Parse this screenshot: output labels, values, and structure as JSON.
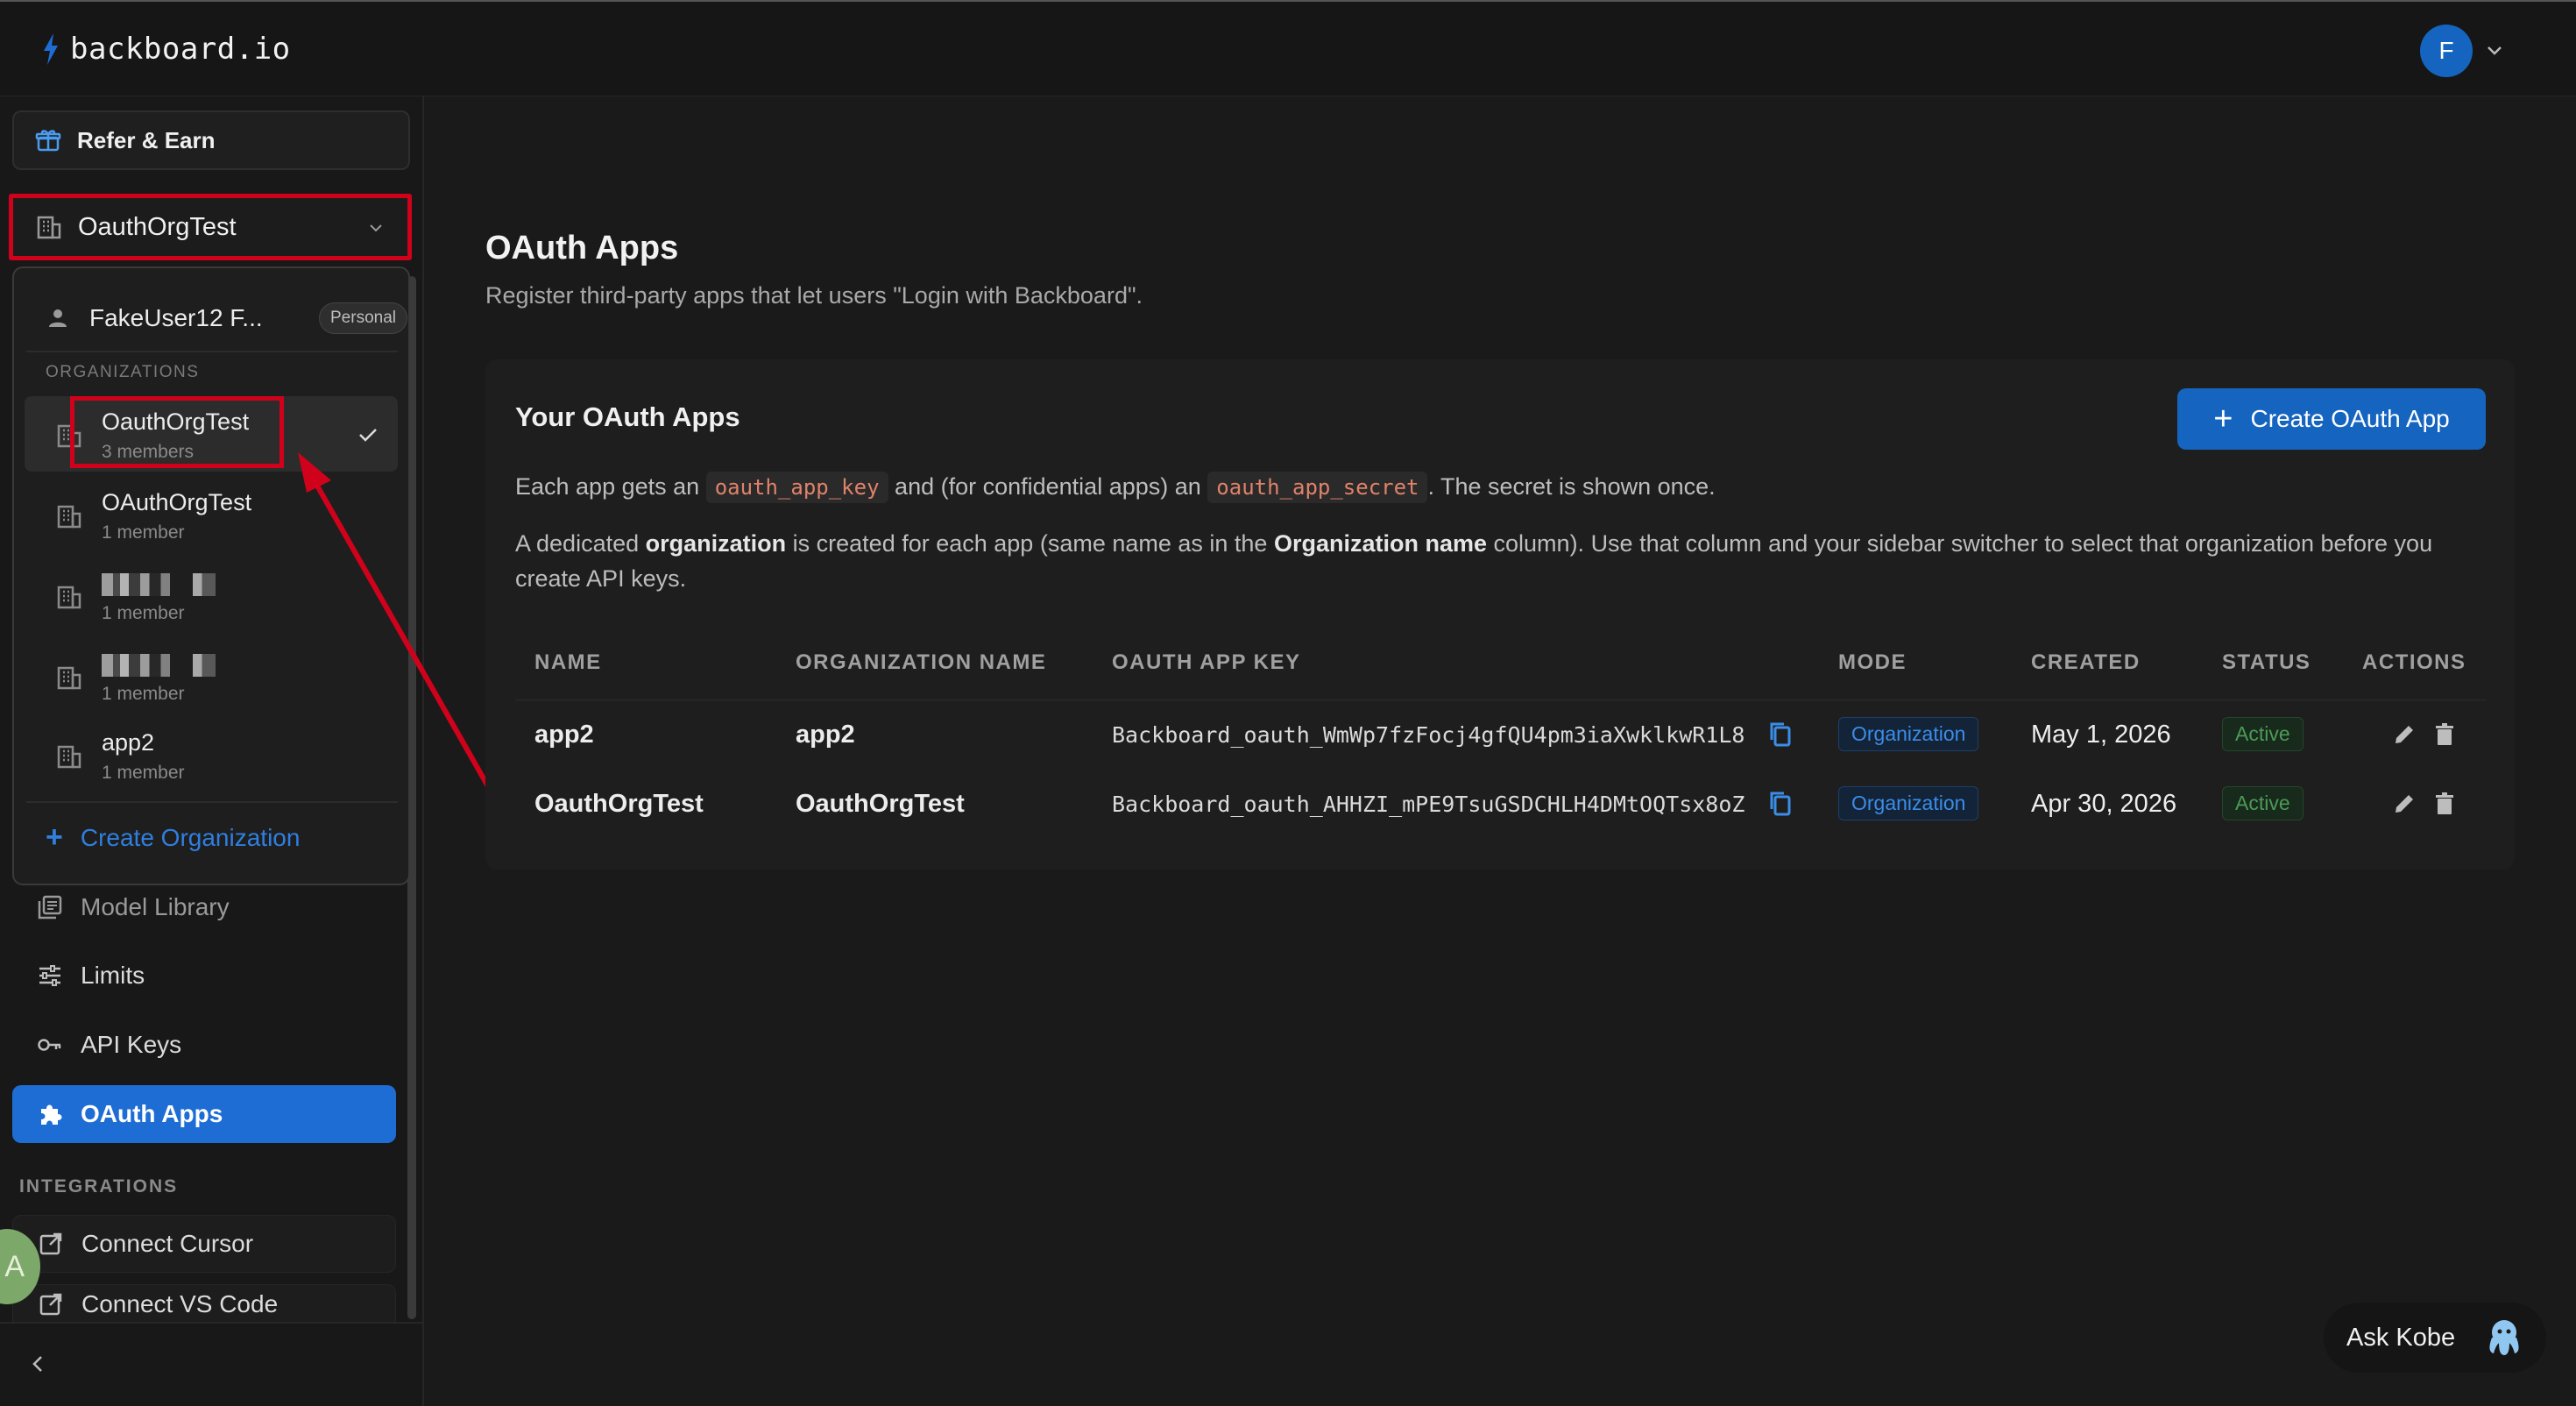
{
  "app": {
    "logo_text": "backboard.io"
  },
  "user": {
    "avatar_initial": "F"
  },
  "sidebar": {
    "refer_label": "Refer & Earn",
    "current_org": "OauthOrgTest",
    "nav_items": [
      {
        "label": "Model Library",
        "icon": "library-icon"
      },
      {
        "label": "Limits",
        "icon": "sliders-icon"
      },
      {
        "label": "API Keys",
        "icon": "key-icon"
      },
      {
        "label": "OAuth Apps",
        "icon": "puzzle-icon",
        "active": true
      }
    ],
    "integrations_label": "INTEGRATIONS",
    "integrations": [
      {
        "label": "Connect Cursor",
        "icon": "external-link-icon"
      },
      {
        "label": "Connect VS Code",
        "icon": "external-link-icon"
      }
    ],
    "green_avatar_text": "A"
  },
  "org_dropdown": {
    "personal": {
      "name": "FakeUser12 F...",
      "badge": "Personal"
    },
    "section_label": "ORGANIZATIONS",
    "orgs": [
      {
        "name": "OauthOrgTest",
        "members": "3 members",
        "selected": true
      },
      {
        "name": "OAuthOrgTest",
        "members": "1 member"
      },
      {
        "name": "",
        "members": "1 member",
        "redacted": true
      },
      {
        "name": "",
        "members": "1 member",
        "redacted": true
      },
      {
        "name": "app2",
        "members": "1 member"
      }
    ],
    "create_label": "Create Organization"
  },
  "main": {
    "title": "OAuth Apps",
    "subtitle": "Register third-party apps that let users \"Login with Backboard\".",
    "card": {
      "title": "Your OAuth Apps",
      "create_button": "Create OAuth App",
      "desc1": {
        "part1": "Each app gets an",
        "code1": "oauth_app_key",
        "part2": "and (for confidential apps) an",
        "code2": "oauth_app_secret",
        "part3": ". The secret is shown once."
      },
      "desc2": {
        "part1": "A dedicated",
        "bold1": "organization",
        "part2": "is created for each app (same name as in the",
        "bold2": "Organization name",
        "part3": "column). Use that column and your sidebar switcher to select that organization before you create API keys."
      },
      "table": {
        "headers": [
          "NAME",
          "ORGANIZATION NAME",
          "OAUTH APP KEY",
          "MODE",
          "CREATED",
          "STATUS",
          "ACTIONS"
        ],
        "rows": [
          {
            "name": "app2",
            "org": "app2",
            "key": "Backboard_oauth_WmWp7fzFocj4gfQU4pm3iaXwklkwR1L8",
            "mode": "Organization",
            "created": "May 1, 2026",
            "status": "Active"
          },
          {
            "name": "OauthOrgTest",
            "org": "OauthOrgTest",
            "key": "Backboard_oauth_AHHZI_mPE9TsuGSDCHLH4DMtOQTsx8oZ",
            "mode": "Organization",
            "created": "Apr 30, 2026",
            "status": "Active"
          }
        ]
      }
    }
  },
  "assistant": {
    "label": "Ask Kobe"
  },
  "colors": {
    "accent": "#1565c0",
    "annotation_red": "#d0021b",
    "background": "#1a1a1a"
  }
}
